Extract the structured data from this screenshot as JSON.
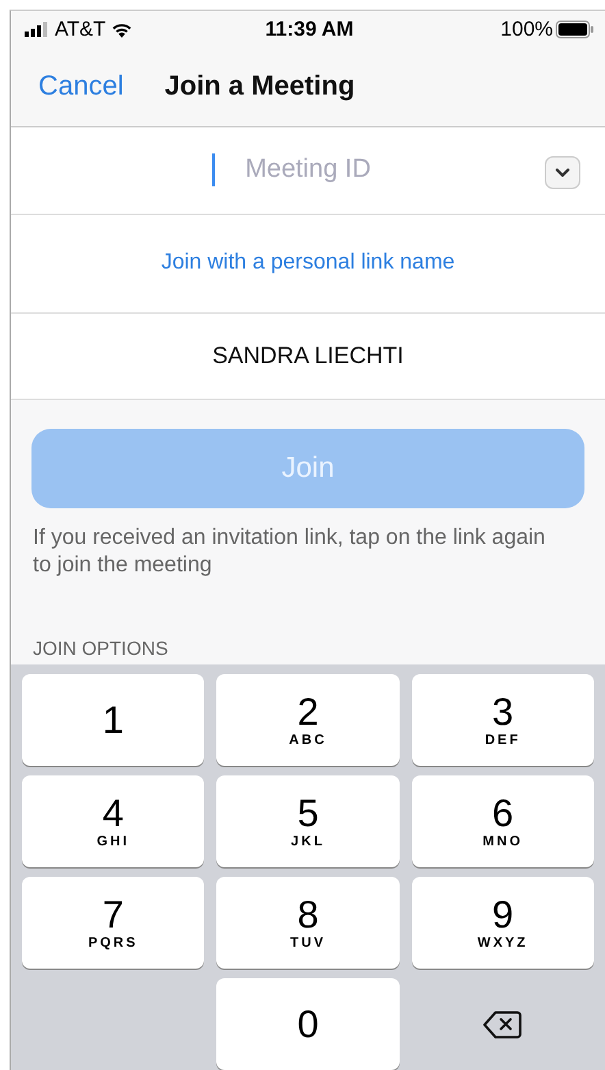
{
  "status_bar": {
    "carrier": "AT&T",
    "time": "11:39 AM",
    "battery": "100%"
  },
  "nav": {
    "cancel": "Cancel",
    "title": "Join a Meeting"
  },
  "meeting_id": {
    "placeholder": "Meeting ID"
  },
  "personal_link": "Join with a personal link name",
  "name_field": {
    "value": "SANDRA LIECHTI"
  },
  "join_button": {
    "label": "Join",
    "disabled": true
  },
  "hint": "If you received an invitation link, tap on the link again to join the meeting",
  "section_header": "JOIN OPTIONS",
  "keypad": [
    {
      "kind": "digit",
      "digit": "1"
    },
    {
      "kind": "digit",
      "digit": "2",
      "letters": "ABC"
    },
    {
      "kind": "digit",
      "digit": "3",
      "letters": "DEF"
    },
    {
      "kind": "digit",
      "digit": "4",
      "letters": "GHI"
    },
    {
      "kind": "digit",
      "digit": "5",
      "letters": "JKL"
    },
    {
      "kind": "digit",
      "digit": "6",
      "letters": "MNO"
    },
    {
      "kind": "digit",
      "digit": "7",
      "letters": "PQRS"
    },
    {
      "kind": "digit",
      "digit": "8",
      "letters": "TUV"
    },
    {
      "kind": "digit",
      "digit": "9",
      "letters": "WXYZ"
    },
    {
      "kind": "blank"
    },
    {
      "kind": "digit",
      "digit": "0"
    },
    {
      "kind": "delete"
    }
  ]
}
